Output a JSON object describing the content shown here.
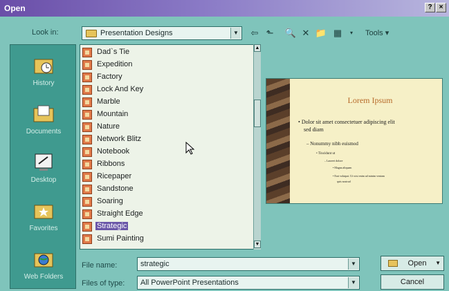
{
  "window": {
    "title": "Open",
    "help_glyph": "?",
    "close_glyph": "×"
  },
  "lookin": {
    "label": "Look in:",
    "value": "Presentation Designs"
  },
  "toolbar": {
    "tools_label": "Tools"
  },
  "places": [
    {
      "label": "History",
      "icon": "history-icon"
    },
    {
      "label": "Documents",
      "icon": "documents-icon"
    },
    {
      "label": "Desktop",
      "icon": "desktop-icon"
    },
    {
      "label": "Favorites",
      "icon": "favorites-icon"
    },
    {
      "label": "Web Folders",
      "icon": "web-folders-icon"
    }
  ],
  "files": [
    "Dad`s Tie",
    "Expedition",
    "Factory",
    "Lock And Key",
    "Marble",
    "Mountain",
    "Nature",
    "Network Blitz",
    "Notebook",
    "Ribbons",
    "Ricepaper",
    "Sandstone",
    "Soaring",
    "Straight Edge",
    "Strategic",
    "Sumi Painting"
  ],
  "selected_file": "Strategic",
  "preview": {
    "title": "Lorem Ipsum",
    "lines": [
      "Dolor sit amet consectetuer adipiscing elit",
      "sed diam",
      "Nonummy nibh euismod",
      "Tincidunt ut",
      "Laoreet dolore",
      "Magna aliquam",
      "Erat volutpat. Ut wisi enim ad minim veniam",
      "quis nostrud"
    ]
  },
  "form": {
    "file_name_label": "File name:",
    "file_name_value": "strategic",
    "file_type_label": "Files of type:",
    "file_type_value": "All PowerPoint Presentations"
  },
  "buttons": {
    "open": "Open",
    "cancel": "Cancel"
  },
  "colors": {
    "title_gradient_start": "#6a4ea8",
    "selection": "#6a56a8",
    "dialog_bg": "#7fc4bb"
  }
}
